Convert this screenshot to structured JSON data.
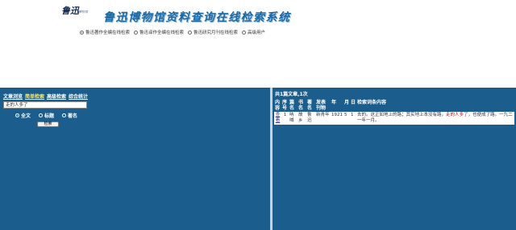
{
  "logo": {
    "text": "鲁迅",
    "tag": "博物馆"
  },
  "site_title": "鲁迅博物馆资料查询在线检索系统",
  "databases": [
    {
      "label": "鲁迅著作全编在线检索",
      "selected": true
    },
    {
      "label": "鲁迅译作全编在线检索",
      "selected": false
    },
    {
      "label": "鲁迅研究月刊在线检索",
      "selected": false
    },
    {
      "label": "高级用户",
      "selected": false
    }
  ],
  "search_panel": {
    "tabs": [
      {
        "label": "文章浏览",
        "active": false
      },
      {
        "label": "简单检索",
        "active": true
      },
      {
        "label": "高级检索",
        "active": false
      },
      {
        "label": "综合统计",
        "active": false
      }
    ],
    "query": "走的人多了",
    "scopes": [
      {
        "label": "全文",
        "selected": true
      },
      {
        "label": "标题",
        "selected": false
      },
      {
        "label": "著名",
        "selected": false
      }
    ],
    "search_button": "检索"
  },
  "results": {
    "summary": "共1篇文章,1次",
    "headers": [
      "内容",
      "序号",
      "篇名",
      "书名",
      "著名",
      "发表刊物",
      "年",
      "月",
      "日",
      "检索词条内容"
    ],
    "rows": [
      {
        "content_link": "查看",
        "index": "1",
        "title": "呐喊",
        "book": "故乡",
        "author": "鲁迅",
        "journal": "新青年",
        "year": "1921",
        "month": "5",
        "day": "1",
        "snippet_before": "去的。这正如地上的路；其实地上本没有路，",
        "snippet_hit": "走的人多了",
        "snippet_after": "，也便成了路。一九二一年一月。"
      }
    ]
  },
  "colors": {
    "panel_bg": "#1b5e8e",
    "title": "#1b6aa4",
    "active_tab": "#ffe866",
    "highlight": "#e00000"
  }
}
